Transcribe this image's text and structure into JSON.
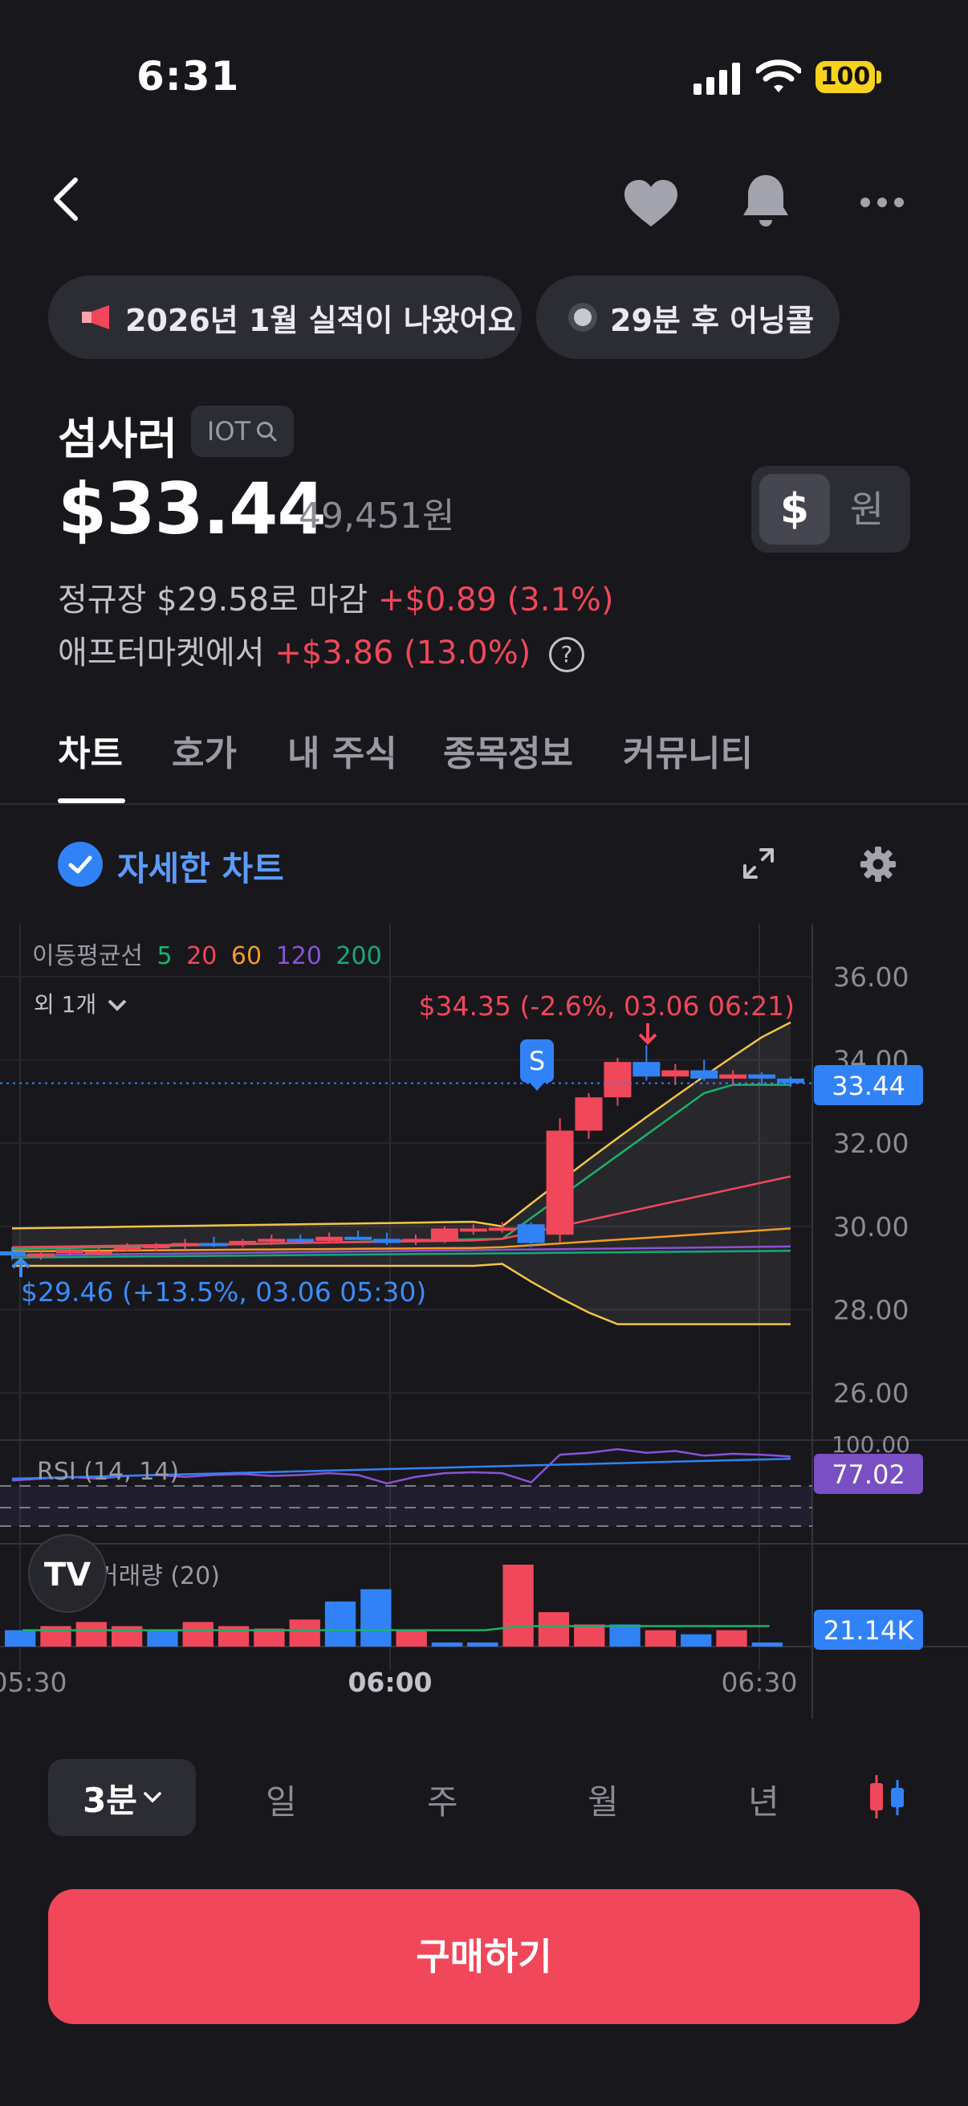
{
  "status_bar": {
    "time": "6:31",
    "battery": "100"
  },
  "banners": [
    {
      "label": "2026년 1월 실적이 나왔어요"
    },
    {
      "label": "29분 후 어닝콜"
    }
  ],
  "stock": {
    "name": "섬사러",
    "ticker": "IOT",
    "price": "$33.44",
    "price_krw": "49,451원",
    "currency_usd": "$",
    "currency_krw": "원",
    "regular_close_prefix": "정규장 $29.58로 마감",
    "regular_change": "+$0.89 (3.1%)",
    "after_prefix": "애프터마켓에서",
    "after_change": "+$3.86 (13.0%)",
    "help": "?"
  },
  "tabs": [
    "차트",
    "호가",
    "내 주식",
    "종목정보",
    "커뮤니티"
  ],
  "detail_chart_label": "자세한 차트",
  "chart_data": {
    "type": "candlestick",
    "ma_legend": {
      "title": "이동평균선",
      "periods": [
        {
          "label": "5",
          "color": "#19b36b"
        },
        {
          "label": "20",
          "color": "#f1475a"
        },
        {
          "label": "60",
          "color": "#f59b23"
        },
        {
          "label": "120",
          "color": "#8a52d6"
        },
        {
          "label": "200",
          "color": "#16a87a"
        }
      ],
      "more": "외 1개"
    },
    "y_ticks": [
      "36.00",
      "34.00",
      "32.00",
      "30.00",
      "28.00",
      "26.00"
    ],
    "ylim": [
      25.5,
      36.5
    ],
    "x_ticks": [
      "05:30",
      "06:00",
      "06:30"
    ],
    "current_price_label": "33.44",
    "current_price": 33.44,
    "high_annotation": "$34.35 (-2.6%, 03.06 06:21)",
    "low_annotation": "$29.46 (+13.5%, 03.06 05:30)",
    "signal_badge": "S",
    "candles": [
      {
        "o": 29.4,
        "h": 29.5,
        "l": 29.2,
        "c": 29.3
      },
      {
        "o": 29.3,
        "h": 29.4,
        "l": 29.2,
        "c": 29.35
      },
      {
        "o": 29.35,
        "h": 29.5,
        "l": 29.3,
        "c": 29.45
      },
      {
        "o": 29.4,
        "h": 29.5,
        "l": 29.3,
        "c": 29.4
      },
      {
        "o": 29.45,
        "h": 29.6,
        "l": 29.4,
        "c": 29.5
      },
      {
        "o": 29.5,
        "h": 29.6,
        "l": 29.4,
        "c": 29.55
      },
      {
        "o": 29.55,
        "h": 29.7,
        "l": 29.45,
        "c": 29.6
      },
      {
        "o": 29.6,
        "h": 29.75,
        "l": 29.5,
        "c": 29.55
      },
      {
        "o": 29.6,
        "h": 29.7,
        "l": 29.5,
        "c": 29.65
      },
      {
        "o": 29.65,
        "h": 29.8,
        "l": 29.55,
        "c": 29.7
      },
      {
        "o": 29.7,
        "h": 29.8,
        "l": 29.6,
        "c": 29.65
      },
      {
        "o": 29.65,
        "h": 29.85,
        "l": 29.6,
        "c": 29.75
      },
      {
        "o": 29.75,
        "h": 29.9,
        "l": 29.7,
        "c": 29.7
      },
      {
        "o": 29.7,
        "h": 29.85,
        "l": 29.55,
        "c": 29.6
      },
      {
        "o": 29.62,
        "h": 29.8,
        "l": 29.55,
        "c": 29.7
      },
      {
        "o": 29.65,
        "h": 30.0,
        "l": 29.6,
        "c": 29.95
      },
      {
        "o": 29.95,
        "h": 30.05,
        "l": 29.8,
        "c": 29.95
      },
      {
        "o": 29.95,
        "h": 30.1,
        "l": 29.85,
        "c": 29.97
      },
      {
        "o": 30.05,
        "h": 30.1,
        "l": 29.5,
        "c": 29.6
      },
      {
        "o": 29.8,
        "h": 32.6,
        "l": 29.6,
        "c": 32.3
      },
      {
        "o": 32.3,
        "h": 33.2,
        "l": 32.1,
        "c": 33.1
      },
      {
        "o": 33.1,
        "h": 34.05,
        "l": 32.9,
        "c": 33.95
      },
      {
        "o": 33.95,
        "h": 34.35,
        "l": 33.5,
        "c": 33.6
      },
      {
        "o": 33.6,
        "h": 33.9,
        "l": 33.4,
        "c": 33.75
      },
      {
        "o": 33.75,
        "h": 34.0,
        "l": 33.5,
        "c": 33.55
      },
      {
        "o": 33.55,
        "h": 33.75,
        "l": 33.4,
        "c": 33.65
      },
      {
        "o": 33.65,
        "h": 33.7,
        "l": 33.4,
        "c": 33.55
      },
      {
        "o": 33.55,
        "h": 33.6,
        "l": 33.35,
        "c": 33.44
      }
    ],
    "rsi": {
      "label": "RSI (14, 14)",
      "value_label": "77.02",
      "top_tick": "100.00"
    },
    "volume": {
      "label": "거래량 (20)",
      "value_label": "21.14K",
      "bars": [
        0.2,
        0.25,
        0.3,
        0.25,
        0.2,
        0.3,
        0.25,
        0.22,
        0.33,
        0.55,
        0.7,
        0.2,
        0.05,
        0.05,
        1.0,
        0.42,
        0.27,
        0.27,
        0.2,
        0.15,
        0.2,
        0.05
      ],
      "up": [
        false,
        true,
        true,
        true,
        false,
        true,
        true,
        true,
        true,
        false,
        false,
        true,
        false,
        false,
        true,
        true,
        true,
        false,
        true,
        false,
        true,
        false
      ]
    }
  },
  "timeframes": {
    "selected": "3분",
    "items": [
      "일",
      "주",
      "월",
      "년"
    ]
  },
  "buy_button": "구매하기",
  "colors": {
    "up": "#f1475a",
    "down": "#3182f6",
    "background": "#17171c"
  }
}
